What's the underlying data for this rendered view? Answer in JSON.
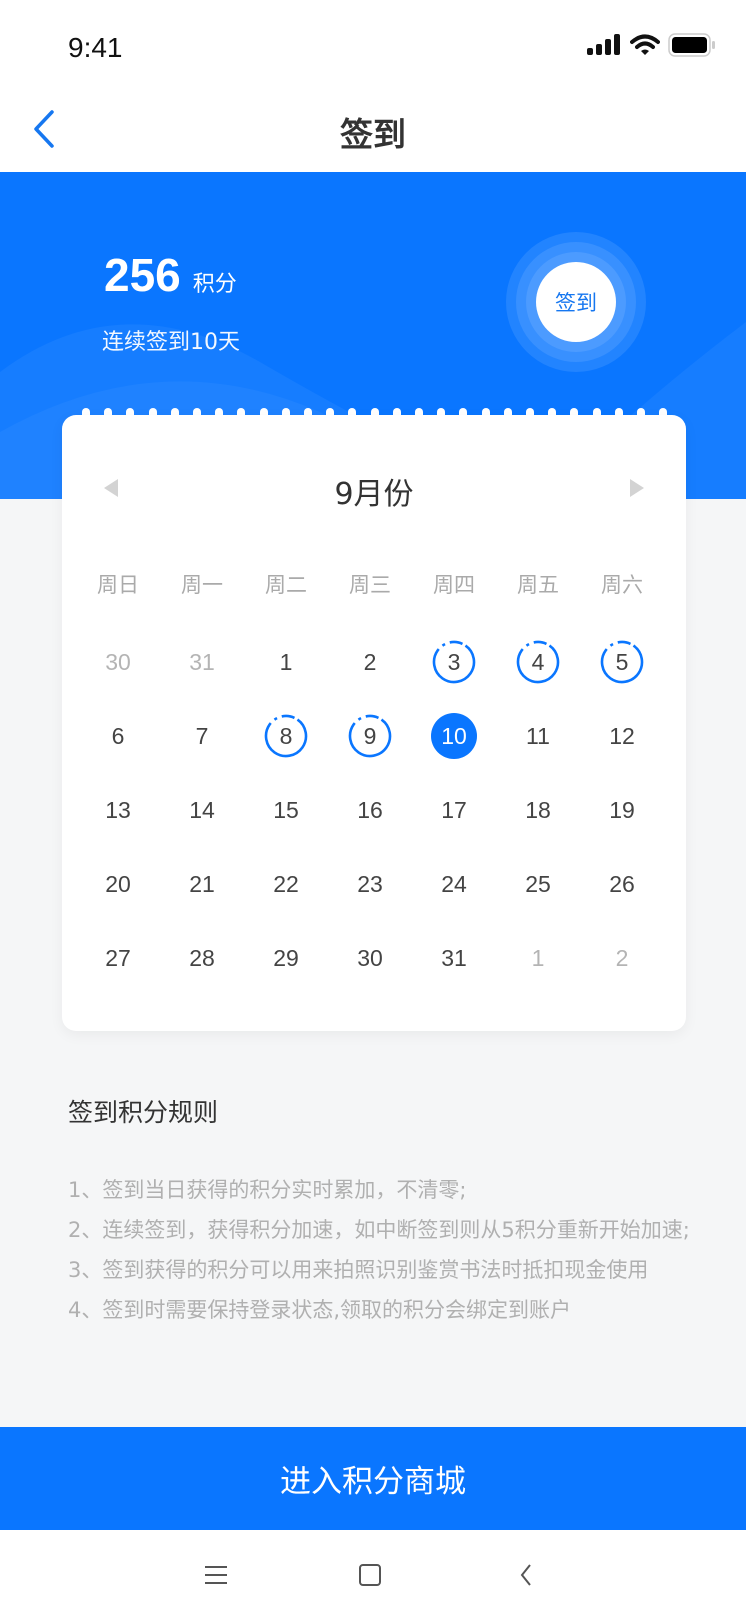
{
  "status_bar": {
    "time": "9:41",
    "icons": [
      "signal-icon",
      "wifi-icon",
      "battery-icon"
    ]
  },
  "nav": {
    "title": "签到",
    "back_icon": "chevron-left-icon"
  },
  "banner": {
    "points_value": "256",
    "points_unit": "积分",
    "streak_text": "连续签到10天",
    "sign_button_label": "签到",
    "color": "#0a76ff"
  },
  "calendar": {
    "month_title": "9月份",
    "prev_icon": "triangle-left-icon",
    "next_icon": "triangle-right-icon",
    "weekdays": [
      "周日",
      "周一",
      "周二",
      "周三",
      "周四",
      "周五",
      "周六"
    ],
    "days": [
      {
        "label": "30",
        "state": "other-month"
      },
      {
        "label": "31",
        "state": "other-month"
      },
      {
        "label": "1",
        "state": "normal"
      },
      {
        "label": "2",
        "state": "normal"
      },
      {
        "label": "3",
        "state": "signed"
      },
      {
        "label": "4",
        "state": "signed"
      },
      {
        "label": "5",
        "state": "signed"
      },
      {
        "label": "6",
        "state": "normal"
      },
      {
        "label": "7",
        "state": "normal"
      },
      {
        "label": "8",
        "state": "signed"
      },
      {
        "label": "9",
        "state": "signed"
      },
      {
        "label": "10",
        "state": "today"
      },
      {
        "label": "11",
        "state": "normal"
      },
      {
        "label": "12",
        "state": "normal"
      },
      {
        "label": "13",
        "state": "normal"
      },
      {
        "label": "14",
        "state": "normal"
      },
      {
        "label": "15",
        "state": "normal"
      },
      {
        "label": "16",
        "state": "normal"
      },
      {
        "label": "17",
        "state": "normal"
      },
      {
        "label": "18",
        "state": "normal"
      },
      {
        "label": "19",
        "state": "normal"
      },
      {
        "label": "20",
        "state": "normal"
      },
      {
        "label": "21",
        "state": "normal"
      },
      {
        "label": "22",
        "state": "normal"
      },
      {
        "label": "23",
        "state": "normal"
      },
      {
        "label": "24",
        "state": "normal"
      },
      {
        "label": "25",
        "state": "normal"
      },
      {
        "label": "26",
        "state": "normal"
      },
      {
        "label": "27",
        "state": "normal"
      },
      {
        "label": "28",
        "state": "normal"
      },
      {
        "label": "29",
        "state": "normal"
      },
      {
        "label": "30",
        "state": "normal"
      },
      {
        "label": "31",
        "state": "normal"
      },
      {
        "label": "1",
        "state": "other-month"
      },
      {
        "label": "2",
        "state": "other-month"
      }
    ]
  },
  "rules": {
    "title": "签到积分规则",
    "items": [
      "1、签到当日获得的积分实时累加，不清零;",
      "2、连续签到，获得积分加速，如中断签到则从5积分重新开始加速;",
      "3、签到获得的积分可以用来拍照识别鉴赏书法时抵扣现金使用",
      "4、签到时需要保持登录状态,领取的积分会绑定到账户"
    ]
  },
  "footer": {
    "mall_button_label": "进入积分商城"
  },
  "system_nav": {
    "icons": [
      "menu-icon",
      "home-square-icon",
      "back-chevron-icon"
    ]
  }
}
